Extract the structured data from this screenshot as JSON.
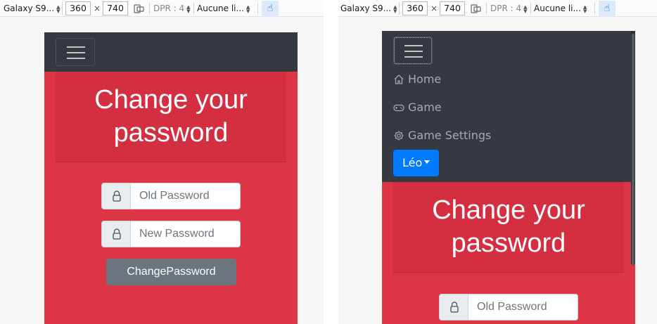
{
  "toolbar": {
    "device": "Galaxy S9...",
    "width": "360",
    "times": "×",
    "height": "740",
    "dpr": "DPR : 4",
    "throttle": "Aucune li..."
  },
  "navbar": {
    "items": [
      {
        "label": "Home",
        "icon": "house-icon"
      },
      {
        "label": "Game",
        "icon": "gamepad-icon"
      },
      {
        "label": "Game Settings",
        "icon": "gear-icon"
      }
    ],
    "user": {
      "label": "Léo"
    }
  },
  "page": {
    "title_line1": "Change your",
    "title_line2": "password",
    "old_password_placeholder": "Old Password",
    "new_password_placeholder": "New Password",
    "submit_label": "ChangePassword"
  },
  "colors": {
    "danger": "#dc3545",
    "dark": "#343a40",
    "primary": "#007bff",
    "secondary": "#6c757d"
  }
}
